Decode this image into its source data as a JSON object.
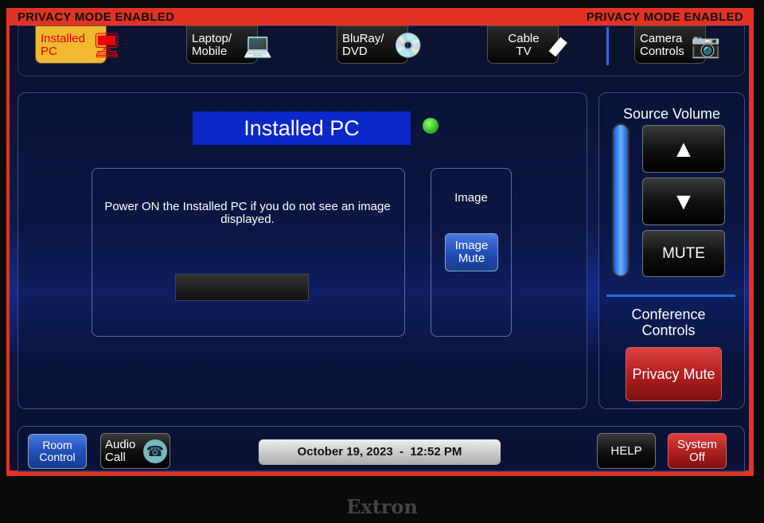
{
  "privacy_banner": {
    "left": "PRIVACY MODE ENABLED",
    "right": "PRIVACY MODE ENABLED",
    "color": "#e23223"
  },
  "sources": [
    {
      "label": "Installed PC",
      "line1": "Installed",
      "line2": "PC",
      "icon": "desktop-pc-icon",
      "active": true
    },
    {
      "label": "Laptop/ Mobile",
      "line1": "Laptop/",
      "line2": "Mobile",
      "icon": "laptop-icon"
    },
    {
      "label": "BluRay/ DVD",
      "line1": "BluRay/",
      "line2": "DVD",
      "icon": "disc-icon"
    },
    {
      "label": "Cable TV",
      "line1": "Cable",
      "line2": "TV",
      "icon": "remote-icon"
    },
    {
      "label": "Camera Controls",
      "line1": "Camera",
      "line2": "Controls",
      "icon": "camera-icon"
    }
  ],
  "main": {
    "title": "Installed PC",
    "status_color": "#33cc33",
    "message": "Power ON the Installed PC if you do not see an image displayed.",
    "image_label": "Image",
    "image_mute": "Image Mute"
  },
  "volume": {
    "title": "Source Volume",
    "up_icon": "arrow-up-icon",
    "down_icon": "arrow-down-icon",
    "mute": "MUTE"
  },
  "conference": {
    "title": "Conference Controls",
    "privacy_mute": "Privacy Mute"
  },
  "bottom": {
    "room_control": "Room Control",
    "audio_call": "Audio Call",
    "datetime": "October 19, 2023  -  12:52 PM",
    "help": "HELP",
    "system_off": "System Off"
  },
  "brand": "Extron"
}
